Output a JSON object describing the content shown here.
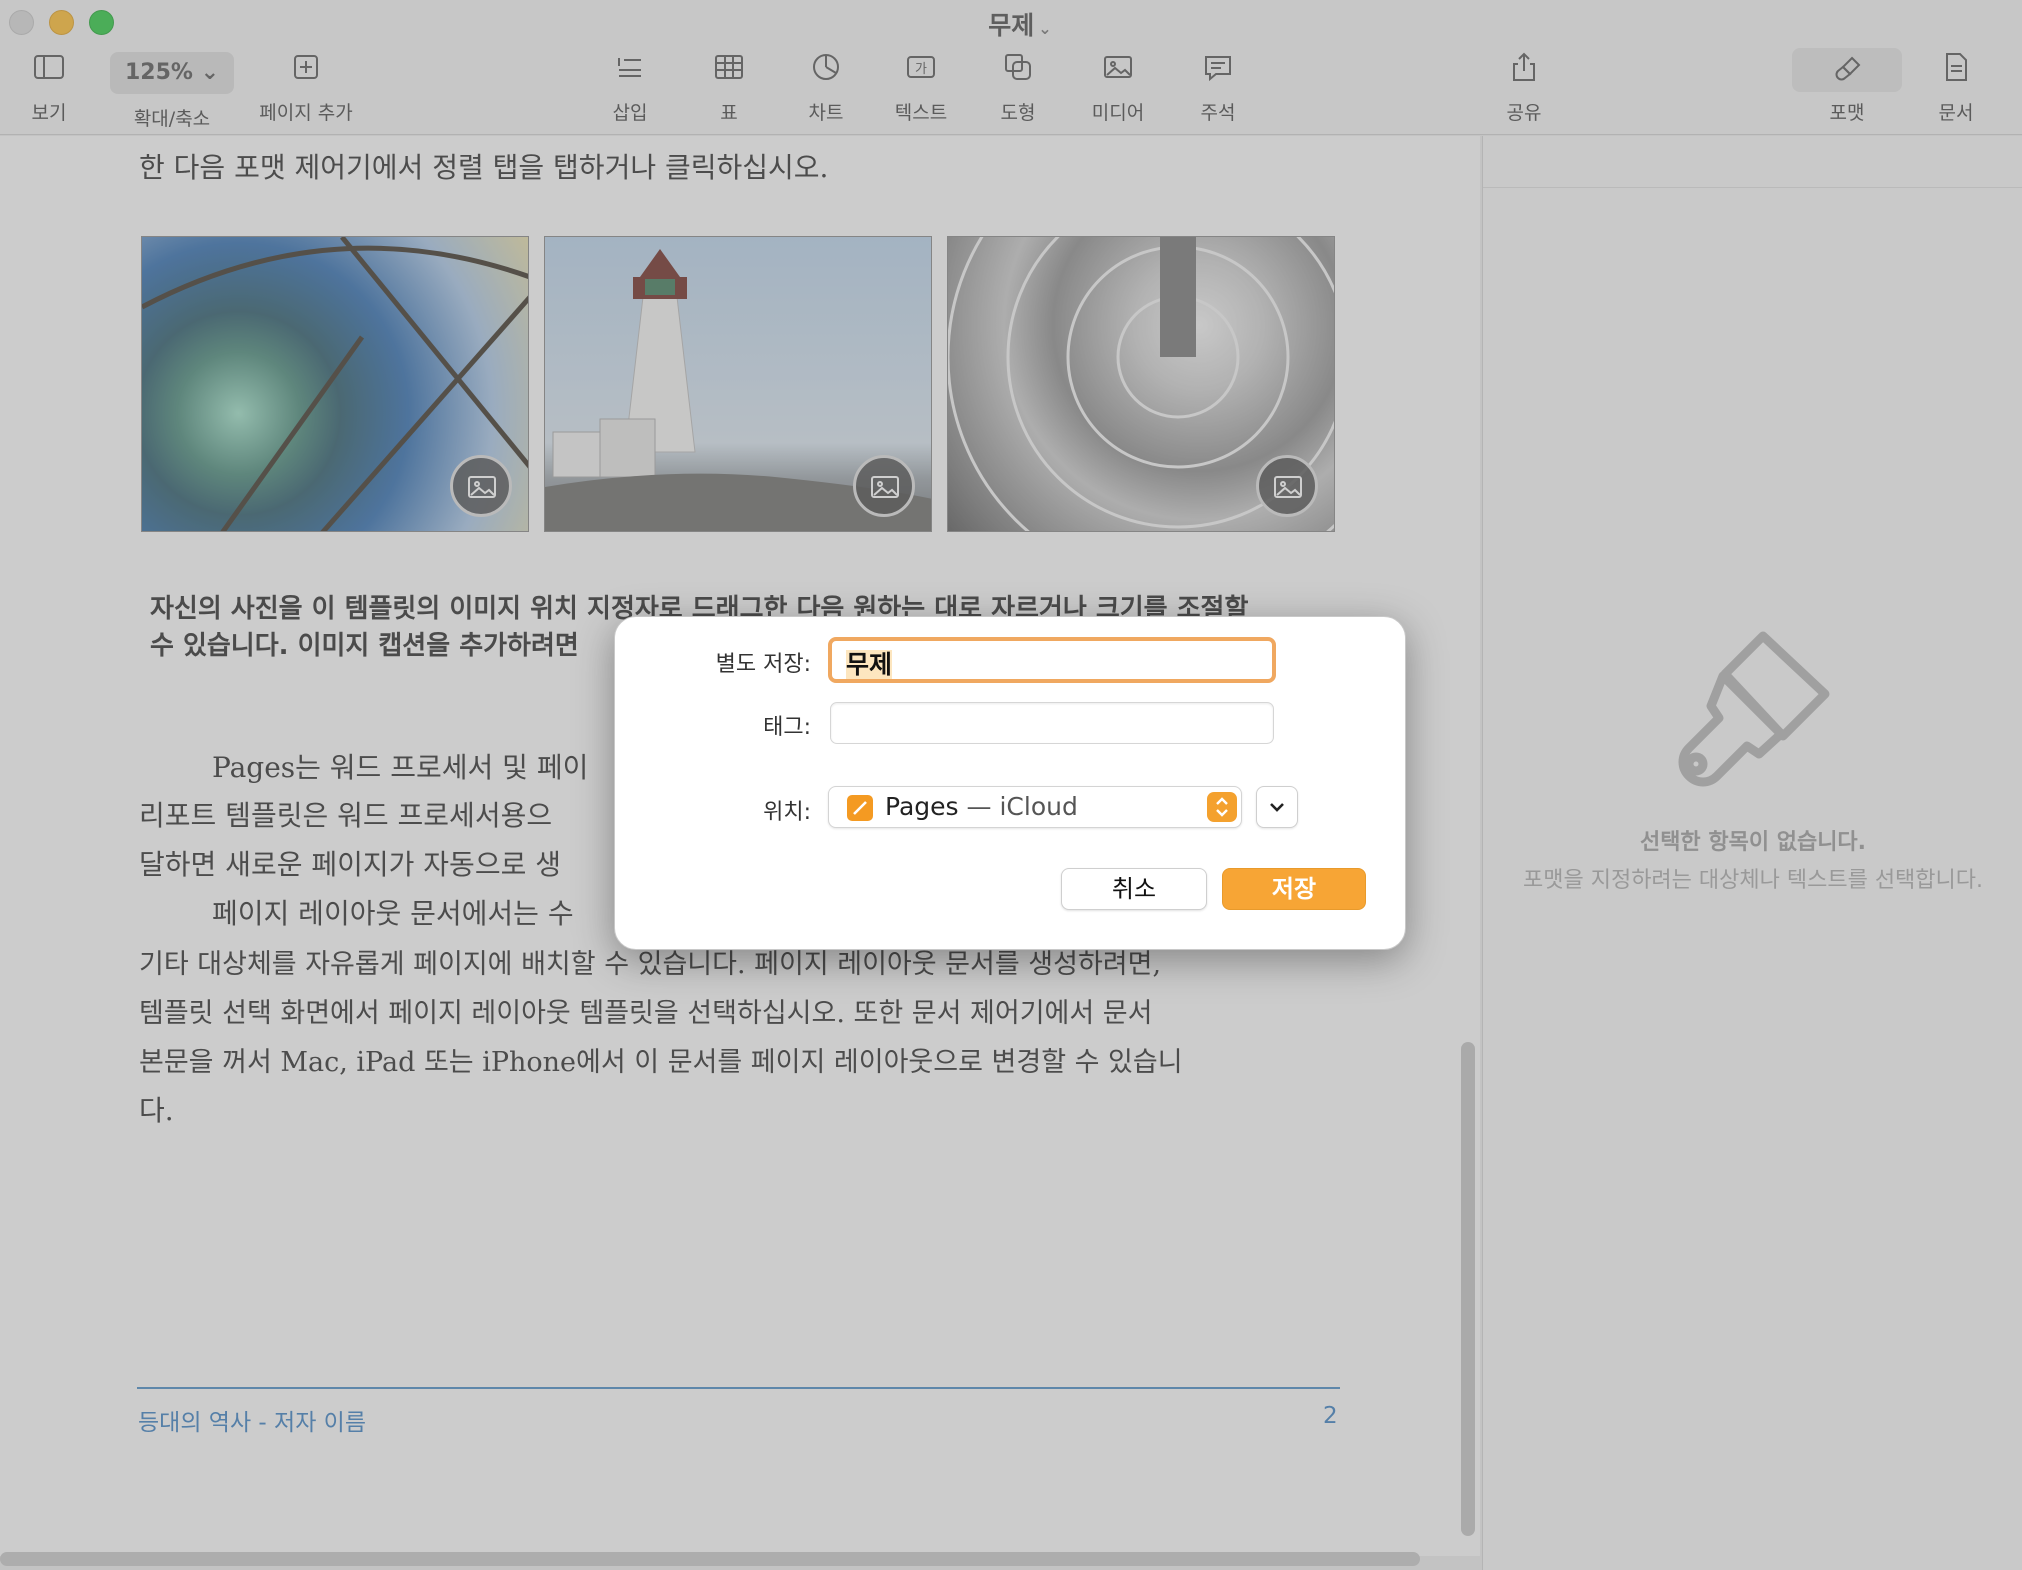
{
  "window": {
    "title": "무제"
  },
  "toolbar": {
    "view_label": "보기",
    "zoom_value": "125%",
    "zoom_label": "확대/축소",
    "add_page_label": "페이지 추가",
    "insert_label": "삽입",
    "table_label": "표",
    "chart_label": "차트",
    "text_label": "텍스트",
    "shape_label": "도형",
    "media_label": "미디어",
    "comment_label": "주석",
    "share_label": "공유",
    "format_label": "포맷",
    "document_label": "문서"
  },
  "document": {
    "intro_line": "한 다음 포맷 제어기에서 정렬 탭을 탭하거나 클릭하십시오.",
    "caption_line1": "자신의 사진을 이 템플릿의 이미지 위치 지정자로 드래그한 다음 원하는 대로 자르거나 크기를 조절할",
    "caption_line2": "수 있습니다. 이미지 캡션을 추가하려면",
    "body_lines": [
      "Pages는 워드 프로세서 및 페이",
      "리포트 템플릿은 워드 프로세서용으",
      "달하면 새로운 페이지가 자동으로 생",
      "페이지 레이아웃 문서에서는 수",
      "기타 대상체를 자유롭게 페이지에 배치할 수 있습니다. 페이지 레이아웃 문서를 생성하려면,",
      "템플릿 선택 화면에서 페이지 레이아웃 템플릿을 선택하십시오. 또한 문서 제어기에서 문서",
      "본문을 꺼서 Mac, iPad 또는 iPhone에서 이 문서를 페이지 레이아웃으로 변경할 수 있습니",
      "다."
    ],
    "footer_left": "등대의 역사 - 저자 이름",
    "footer_page": "2"
  },
  "sidebar": {
    "empty_title": "선택한 항목이 없습니다.",
    "empty_desc": "포맷을 지정하려는 대상체나 텍스트를 선택합니다."
  },
  "save_dialog": {
    "save_as_label": "별도 저장:",
    "save_as_value": "무제",
    "tags_label": "태그:",
    "location_label": "위치:",
    "location_app": "Pages",
    "location_separator": " — ",
    "location_service": "iCloud",
    "cancel_label": "취소",
    "save_label": "저장"
  },
  "colors": {
    "accent": "#f7a535",
    "focus_ring": "#f0a860",
    "footer_blue": "#3a7fc0"
  },
  "icons": [
    "sidebar-icon",
    "plus-icon",
    "insert-icon",
    "table-icon",
    "chart-icon",
    "text-box-icon",
    "shape-icon",
    "media-icon",
    "comment-icon",
    "share-icon",
    "paintbrush-icon",
    "document-icon",
    "image-placeholder-icon",
    "pages-app-icon",
    "stepper-icon",
    "chevron-down-icon"
  ]
}
